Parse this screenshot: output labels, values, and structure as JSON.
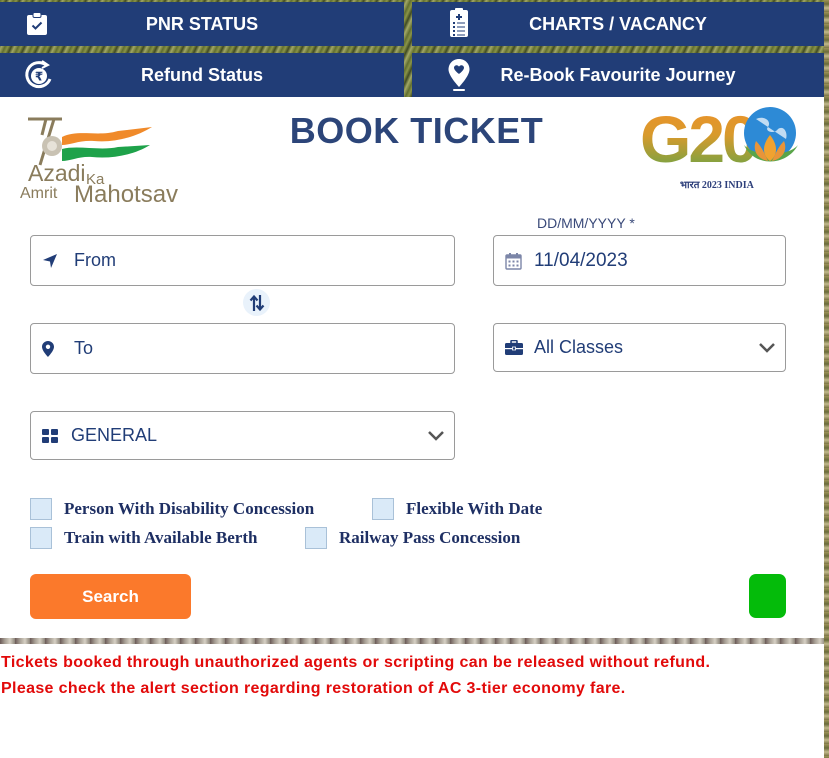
{
  "nav": {
    "pnr_status": "PNR STATUS",
    "charts_vacancy": "CHARTS / VACANCY",
    "refund_status": "Refund Status",
    "rebook_journey": "Re-Book Favourite Journey"
  },
  "card": {
    "title": "BOOK TICKET",
    "logo_left": {
      "line1": "Azadi",
      "line2": "Ka",
      "line3": "Amrit",
      "line4": "Mahotsav"
    },
    "logo_right": {
      "main": "G20",
      "sub": "भारत 2023 INDIA"
    }
  },
  "form": {
    "from": {
      "placeholder": "From",
      "value": ""
    },
    "to": {
      "placeholder": "To",
      "value": ""
    },
    "date": {
      "label": "DD/MM/YYYY *",
      "value": "11/04/2023"
    },
    "class": {
      "selected": "All Classes"
    },
    "quota": {
      "selected": "GENERAL"
    },
    "checkboxes": [
      {
        "label": "Person With Disability Concession",
        "checked": false
      },
      {
        "label": "Flexible With Date",
        "checked": false
      },
      {
        "label": "Train with Available Berth",
        "checked": false
      },
      {
        "label": "Railway Pass Concession",
        "checked": false
      }
    ],
    "search_label": "Search"
  },
  "notices": [
    "Tickets booked through unauthorized agents or scripting can be released without refund.",
    "Please check the alert section regarding restoration of AC 3-tier economy fare."
  ],
  "colors": {
    "nav_bg": "#213d77",
    "title": "#2c4579",
    "search_button": "#fb792b",
    "green_button": "#04bb0a",
    "notice_text": "#e20a0a"
  }
}
